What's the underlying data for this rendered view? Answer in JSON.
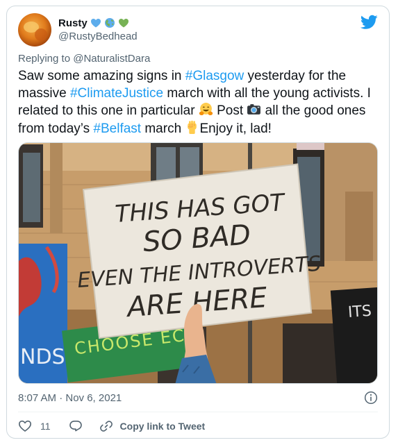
{
  "tweet": {
    "author": {
      "display_name": "Rusty",
      "handle": "@RustyBedhead",
      "name_emojis": [
        "blue-heart-icon",
        "earth-globe-icon",
        "green-heart-icon"
      ]
    },
    "reply_prefix": "Replying to",
    "reply_to": "@NaturalistDara",
    "text": {
      "p1": "Saw some amazing signs in ",
      "tag1": "#Glasgow",
      "p2": " yesterday for the massive ",
      "tag2": "#ClimateJustice",
      "p3": " march with all the young activists. I related to this one in particular ",
      "p4": " Post ",
      "p5": " all the good ones from today’s ",
      "tag3": "#Belfast",
      "p6": " march ",
      "p7": "Enjoy it, lad!"
    },
    "media": {
      "sign_lines": [
        "THIS HAS GOT",
        "SO BAD",
        "EVEN THE INTROVERTS",
        "ARE HERE"
      ],
      "left_sign_text": "NDS",
      "green_sign_text": "CHOOSE ECO",
      "right_sign_text": "ITS FU SS"
    },
    "timestamp": "8:07 AM · Nov 6, 2021",
    "likes": "11",
    "copy_link_label": "Copy link to Tweet"
  },
  "colors": {
    "link": "#1d9bf0",
    "muted": "#536471",
    "like_red": "#f91880",
    "border": "#cfd9de"
  }
}
